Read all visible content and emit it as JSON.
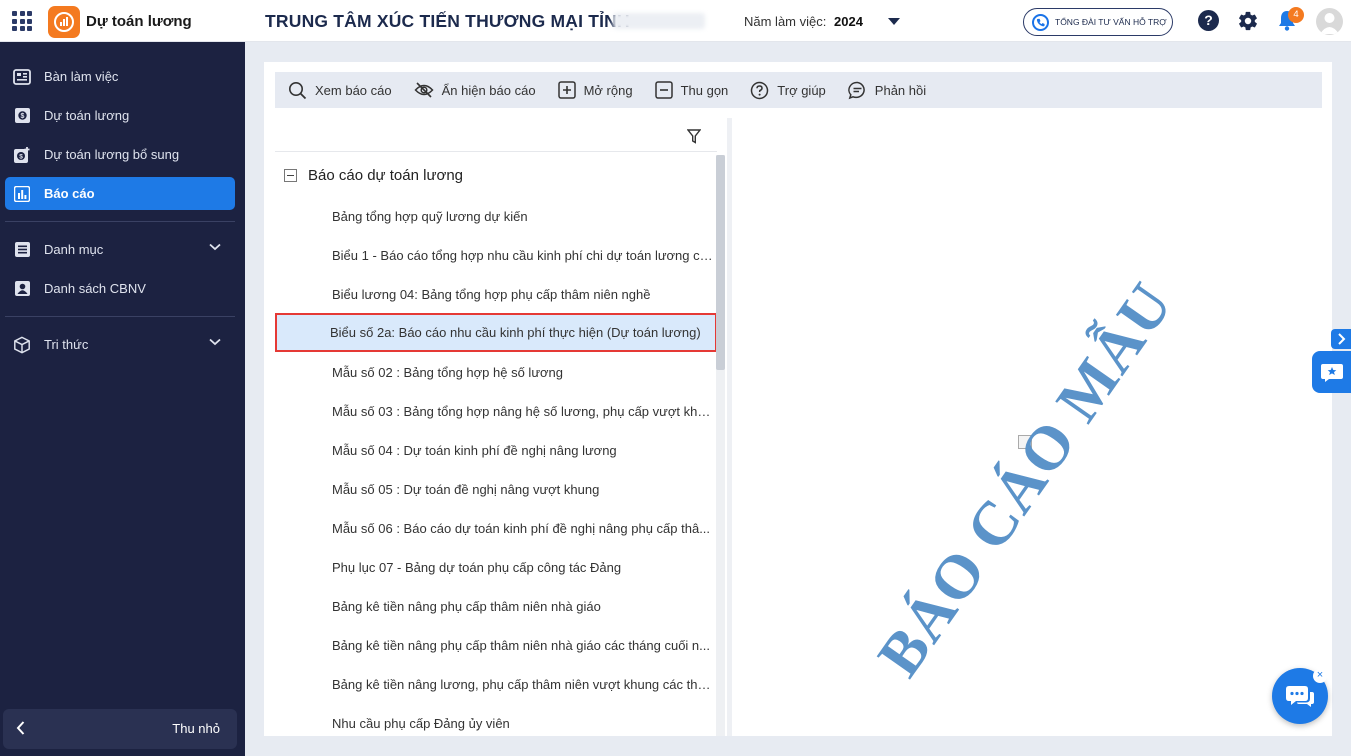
{
  "app": {
    "name": "Dự toán lương",
    "org_title": "TRUNG TÂM XÚC TIẾN THƯƠNG MẠI TỈNH",
    "working_year_label": "Năm làm việc:",
    "working_year": "2024",
    "hotline_label": "TỔNG ĐÀI TƯ VẤN HỖ TRỢ",
    "help_label": "?",
    "notification_count": "4",
    "colors": {
      "primary": "#1e7ae6",
      "sidebar": "#1c2241",
      "accent": "#f47a20",
      "selected_border": "#e53935"
    }
  },
  "sidebar": {
    "items": [
      {
        "label": "Bàn làm việc",
        "icon": "dashboard-icon"
      },
      {
        "label": "Dự toán lương",
        "icon": "salary-estimate-icon"
      },
      {
        "label": "Dự toán lương bổ sung",
        "icon": "salary-supplement-icon"
      },
      {
        "label": "Báo cáo",
        "icon": "report-chart-icon",
        "active": true
      },
      {
        "label": "Danh mục",
        "icon": "catalog-icon",
        "expandable": true
      },
      {
        "label": "Danh sách CBNV",
        "icon": "employee-list-icon"
      },
      {
        "label": "Tri thức",
        "icon": "knowledge-box-icon",
        "expandable": true
      }
    ],
    "collapse_label": "Thu nhỏ"
  },
  "toolbar": {
    "view": "Xem báo cáo",
    "toggle": "Ẩn hiện báo cáo",
    "expand": "Mở rộng",
    "collapse": "Thu gọn",
    "help": "Trợ giúp",
    "feedback": "Phản hồi"
  },
  "tree": {
    "group_label": "Báo cáo dự toán lương",
    "items": [
      "Bảng tổng hợp quỹ lương dự kiến",
      "Biểu 1 - Báo cáo tổng hợp nhu cầu kinh phí chi dự toán lương ch...",
      "Biểu lương 04: Bảng tổng hợp phụ cấp thâm niên nghề",
      "Biểu số 2a: Báo cáo nhu cầu kinh phí thực hiện (Dự toán lương)",
      "Mẫu số 02 : Bảng tổng hợp hệ số lương",
      "Mẫu số 03 : Bảng tổng hợp nâng hệ số lương, phụ cấp vượt khu...",
      "Mẫu số 04 : Dự toán kinh phí đề nghị nâng lương",
      "Mẫu số 05 : Dự toán đề nghị nâng vượt khung",
      "Mẫu số 06 : Báo cáo dự toán kinh phí đề nghị nâng phụ cấp thâ...",
      "Phụ lục 07 - Bảng dự toán phụ cấp công tác Đảng",
      "Bảng kê tiền nâng phụ cấp thâm niên nhà giáo",
      "Bảng kê tiền nâng phụ cấp thâm niên nhà giáo các tháng cuối n...",
      "Bảng kê tiền nâng lương, phụ cấp thâm niên vượt khung các thá...",
      "Nhu cầu phụ cấp Đảng ủy viên"
    ],
    "selected_index": 3
  },
  "preview": {
    "watermark": "BÁO CÁO MẪU"
  }
}
